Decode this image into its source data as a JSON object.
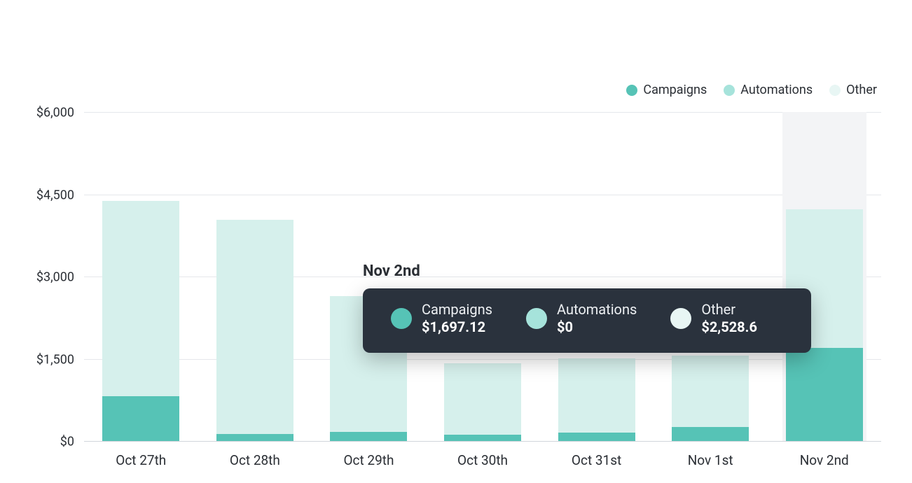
{
  "colors": {
    "campaigns": "#56c3b6",
    "automations": "#a6e3db",
    "other": "#d6f0ec",
    "otherSwatch": "#e8f6f4",
    "tooltipBg": "#2a323d"
  },
  "legend": [
    {
      "key": "campaigns",
      "label": "Campaigns"
    },
    {
      "key": "automations",
      "label": "Automations"
    },
    {
      "key": "other",
      "label": "Other"
    }
  ],
  "chart_data": {
    "type": "bar",
    "stacked": true,
    "ylim": [
      0,
      6000
    ],
    "yticks": [
      0,
      1500,
      3000,
      4500,
      6000
    ],
    "ytick_labels": [
      "$0",
      "$1,500",
      "$3,000",
      "$4,500",
      "$6,000"
    ],
    "categories": [
      "Oct 27th",
      "Oct 28th",
      "Oct 29th",
      "Oct 30th",
      "Oct 31st",
      "Nov 1st",
      "Nov 2nd"
    ],
    "series": [
      {
        "name": "Campaigns",
        "key": "campaigns",
        "values": [
          820,
          130,
          170,
          110,
          150,
          250,
          1697.12
        ]
      },
      {
        "name": "Automations",
        "key": "automations",
        "values": [
          0,
          0,
          0,
          0,
          0,
          0,
          0
        ]
      },
      {
        "name": "Other",
        "key": "other",
        "values": [
          3560,
          3900,
          2470,
          1310,
          1360,
          1310,
          2528.6
        ]
      }
    ],
    "legend_position": "top-right",
    "grid": true
  },
  "tooltip": {
    "visible": true,
    "category_index": 6,
    "title": "Nov 2nd",
    "items": [
      {
        "key": "campaigns",
        "label": "Campaigns",
        "value": "$1,697.12"
      },
      {
        "key": "automations",
        "label": "Automations",
        "value": "$0"
      },
      {
        "key": "other",
        "label": "Other",
        "value": "$2,528.6"
      }
    ]
  }
}
